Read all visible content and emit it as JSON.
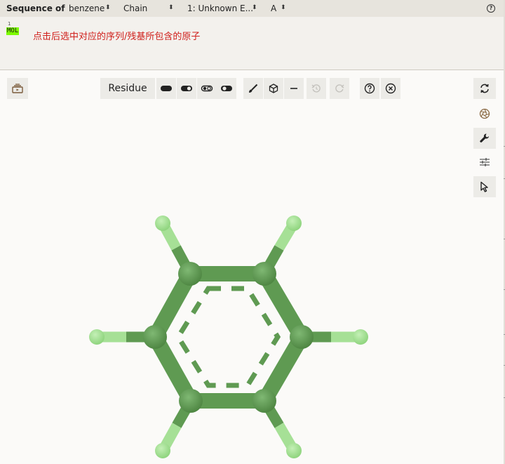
{
  "sequence_panel": {
    "title": "Sequence of",
    "structure_select": "benzene",
    "mode_select": "Chain",
    "chain_select": "1: Unknown E...",
    "chain_id_select": "A",
    "ruler_mark": "1",
    "residue": "MOL",
    "hint": "点击后选中对应的序列/残基所包含的原子"
  },
  "toolbar": {
    "selection_mode": "Residue"
  },
  "colors": {
    "carbon": "#5f9a52",
    "hydrogen": "#9ed98e",
    "residue_highlight": "#7cfc00",
    "hint_text": "#d0201c"
  },
  "icons": [
    "screenshot-icon",
    "style-ball-stick-icon",
    "style-cartoon-icon",
    "style-surface-icon",
    "style-licorice-icon",
    "brush-icon",
    "cube-icon",
    "minus-icon",
    "undo-icon",
    "redo-icon",
    "help-icon",
    "close-icon",
    "rotate-icon",
    "aperture-icon",
    "wrench-icon",
    "sliders-icon",
    "pointer-icon"
  ]
}
